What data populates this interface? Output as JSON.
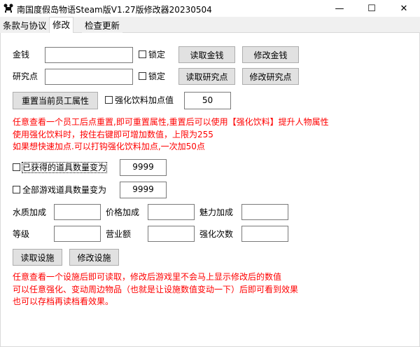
{
  "window": {
    "title": "南国度假岛物语Steam版V1.27版修改器20230504",
    "minimize": "—",
    "maximize": "☐",
    "close": "✕"
  },
  "tabs": [
    {
      "label": "条款与协议"
    },
    {
      "label": "修改"
    },
    {
      "label": "检查更新"
    }
  ],
  "money": {
    "label": "金钱",
    "value": "",
    "lock_label": "锁定",
    "read": "读取金钱",
    "modify": "修改金钱"
  },
  "research": {
    "label": "研究点",
    "value": "",
    "lock_label": "锁定",
    "read": "读取研究点",
    "modify": "修改研究点"
  },
  "reset": {
    "button": "重置当前员工属性",
    "drink_label": "强化饮料加点值",
    "drink_value": "50"
  },
  "notes1": [
    "任意查看一个员工后点重置,即可重置属性,重置后可以使用【强化饮料】提升人物属性",
    "使用强化饮料时，按住右键即可增加数值，上限为255",
    "如果想快速加点.可以打钩强化饮料加点,一次加50点"
  ],
  "items_obtained": {
    "label": "已获得的道具数量变为",
    "value": "9999"
  },
  "items_all": {
    "label": "全部游戏道具数量变为",
    "value": "9999"
  },
  "facility": {
    "water": "水质加成",
    "price": "价格加成",
    "charm": "魅力加成",
    "level": "等级",
    "revenue": "营业额",
    "enhance": "强化次数",
    "read": "读取设施",
    "modify": "修改设施"
  },
  "notes2": [
    "任意查看一个设施后即可读取，修改后游戏里不会马上显示修改后的数值",
    "可以任意强化、变动周边物品（也就是让设施数值变动一下）后即可看到效果",
    "也可以存档再读档看效果。"
  ],
  "colors": {
    "warning": "#ff0000"
  }
}
